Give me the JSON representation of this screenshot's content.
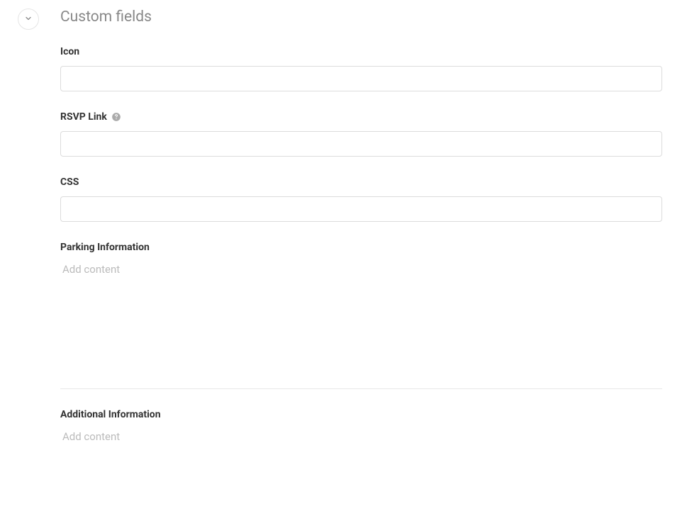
{
  "section": {
    "title": "Custom fields"
  },
  "fields": {
    "icon": {
      "label": "Icon",
      "value": ""
    },
    "rsvp_link": {
      "label": "RSVP Link",
      "value": ""
    },
    "css": {
      "label": "CSS",
      "value": ""
    },
    "parking_info": {
      "label": "Parking Information",
      "placeholder": "Add content"
    },
    "additional_info": {
      "label": "Additional Information",
      "placeholder": "Add content"
    }
  }
}
